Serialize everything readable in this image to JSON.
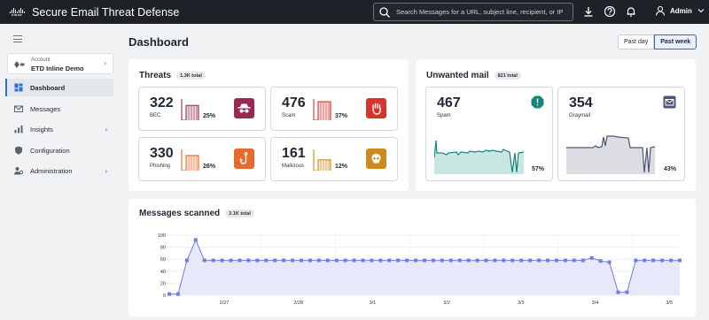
{
  "topbar": {
    "logo_text": "cisco",
    "app_title": "Secure Email Threat Defense",
    "search_placeholder": "Search Messages for a URL, subject line, recipient, or IP",
    "user_name": "Admin"
  },
  "sidebar": {
    "account": {
      "label": "Account",
      "value": "ETD Inline Demo"
    },
    "items": [
      {
        "label": "Dashboard",
        "icon": "dashboard-icon",
        "active": true
      },
      {
        "label": "Messages",
        "icon": "envelope-icon",
        "active": false
      },
      {
        "label": "Insights",
        "icon": "insights-icon",
        "has_submenu": true
      },
      {
        "label": "Configuration",
        "icon": "shield-icon",
        "has_submenu": false
      },
      {
        "label": "Administration",
        "icon": "admin-icon",
        "has_submenu": true
      }
    ]
  },
  "page": {
    "title": "Dashboard",
    "range_options": [
      "Past day",
      "Past week"
    ],
    "range_selected": "Past week"
  },
  "threats": {
    "title": "Threats",
    "badge": "1.3K total",
    "tiles": [
      {
        "value": "322",
        "label": "BEC",
        "pct": "25%",
        "pct_value": 25,
        "color": "#9c2752",
        "icon": "spy-icon"
      },
      {
        "value": "476",
        "label": "Scam",
        "pct": "37%",
        "pct_value": 37,
        "color": "#d9342b",
        "icon": "hand-stop-icon"
      },
      {
        "value": "330",
        "label": "Phishing",
        "pct": "26%",
        "pct_value": 26,
        "color": "#e8692c",
        "icon": "fishhook-icon"
      },
      {
        "value": "161",
        "label": "Malicious",
        "pct": "12%",
        "pct_value": 12,
        "color": "#cf8a1d",
        "icon": "skull-icon"
      }
    ]
  },
  "unwanted": {
    "title": "Unwanted mail",
    "badge": "821 total",
    "tiles": [
      {
        "value": "467",
        "label": "Spam",
        "pct": "57%",
        "color": "#12877d",
        "icon": "alert-octagon-icon"
      },
      {
        "value": "354",
        "label": "Graymail",
        "pct": "43%",
        "color": "#4b5576",
        "icon": "mail-icon"
      }
    ]
  },
  "messages_scanned": {
    "title": "Messages scanned",
    "badge": "3.1K total"
  },
  "chart_data": {
    "type": "area",
    "title": "Messages scanned",
    "y_ticks": [
      0,
      20,
      40,
      60,
      80,
      100
    ],
    "ylim": [
      0,
      100
    ],
    "x_labels": [
      "2/27",
      "2/28",
      "3/1",
      "3/2",
      "3/3",
      "3/4",
      "3/5"
    ],
    "values": [
      2,
      2,
      58,
      92,
      58,
      58,
      58,
      58,
      58,
      58,
      58,
      58,
      58,
      58,
      58,
      58,
      58,
      58,
      58,
      58,
      58,
      58,
      58,
      58,
      58,
      58,
      58,
      58,
      58,
      58,
      58,
      58,
      58,
      58,
      58,
      58,
      58,
      58,
      58,
      58,
      58,
      58,
      58,
      58,
      58,
      58,
      58,
      58,
      62,
      57,
      55,
      5,
      5,
      58,
      58,
      58,
      58,
      58,
      58
    ],
    "color": "#6f7fe0"
  }
}
